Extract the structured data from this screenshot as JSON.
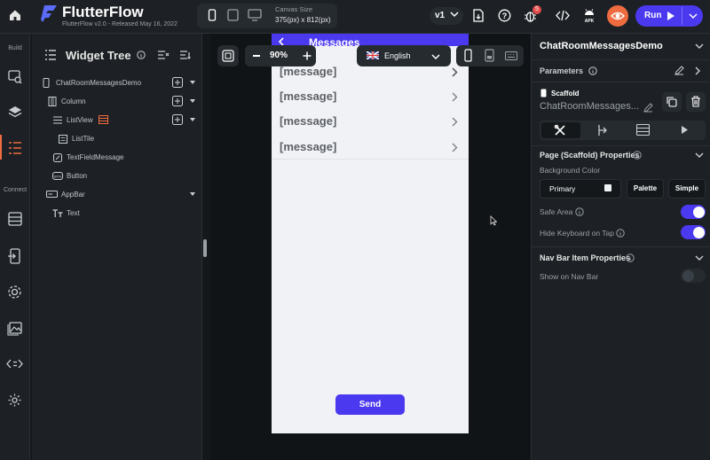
{
  "header": {
    "app_name": "FlutterFlow",
    "release": "FlutterFlow v2.0 - Released May 16, 2022",
    "canvas_size_label": "Canvas Size",
    "canvas_size_value": "375(px) x 812(px)",
    "version": "v1",
    "notification_count": "5",
    "run_label": "Run"
  },
  "rail": {
    "build_label": "Build",
    "connect_label": "Connect"
  },
  "tree": {
    "title": "Widget Tree",
    "items": [
      {
        "label": "ChatRoomMessagesDemo"
      },
      {
        "label": "Column"
      },
      {
        "label": "ListView"
      },
      {
        "label": "ListTile"
      },
      {
        "label": "TextFieldMessage"
      },
      {
        "label": "Button"
      },
      {
        "label": "AppBar"
      },
      {
        "label": "Text"
      }
    ]
  },
  "canvas": {
    "zoom": "90%",
    "language": "English",
    "app_title": "Messages",
    "messages": [
      "[message]",
      "[message]",
      "[message]",
      "[message]"
    ],
    "send_label": "Send"
  },
  "panel": {
    "page_name": "ChatRoomMessagesDemo",
    "parameters_label": "Parameters",
    "scaffold_label": "Scaffold",
    "scaffold_name": "ChatRoomMessages...",
    "page_props_label": "Page (Scaffold) Properties",
    "bg_color_label": "Background Color",
    "bg_color_value": "Primary",
    "palette_label": "Palette",
    "simple_label": "Simple",
    "safe_area_label": "Safe Area",
    "safe_area_on": true,
    "hide_keyboard_label": "Hide Keyboard on Tap",
    "hide_keyboard_on": true,
    "nav_bar_label": "Nav Bar Item Properties",
    "show_nav_label": "Show on Nav Bar",
    "show_nav_on": false
  },
  "colors": {
    "accent": "#4B39EF",
    "orange": "#EF6B40",
    "badge": "#E44B4B"
  }
}
